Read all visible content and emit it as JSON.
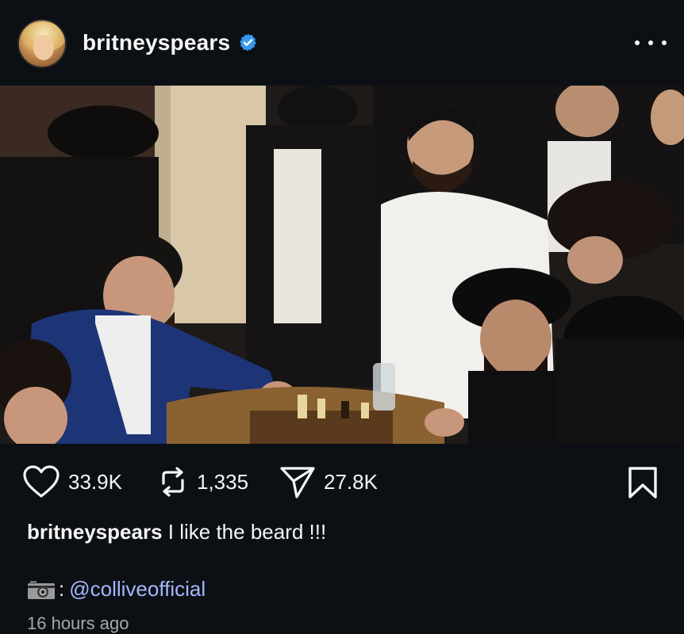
{
  "post": {
    "username": "britneyspears",
    "verified": true,
    "more_icon": "more-horizontal-icon",
    "photo_alt": "",
    "stats": {
      "likes": "33.9K",
      "reposts": "1,335",
      "shares": "27.8K"
    },
    "caption": {
      "user": "britneyspears",
      "text": "I like the beard !!!"
    },
    "credit": {
      "icon": "camera-icon",
      "separator": ":",
      "mention": "@colliveofficial"
    },
    "timestamp": "16 hours ago"
  },
  "colors": {
    "background": "#0c1014",
    "text": "#f5f5f5",
    "verified": "#3897f0",
    "mention": "#a7b7ff",
    "muted": "#a8a8a8"
  }
}
